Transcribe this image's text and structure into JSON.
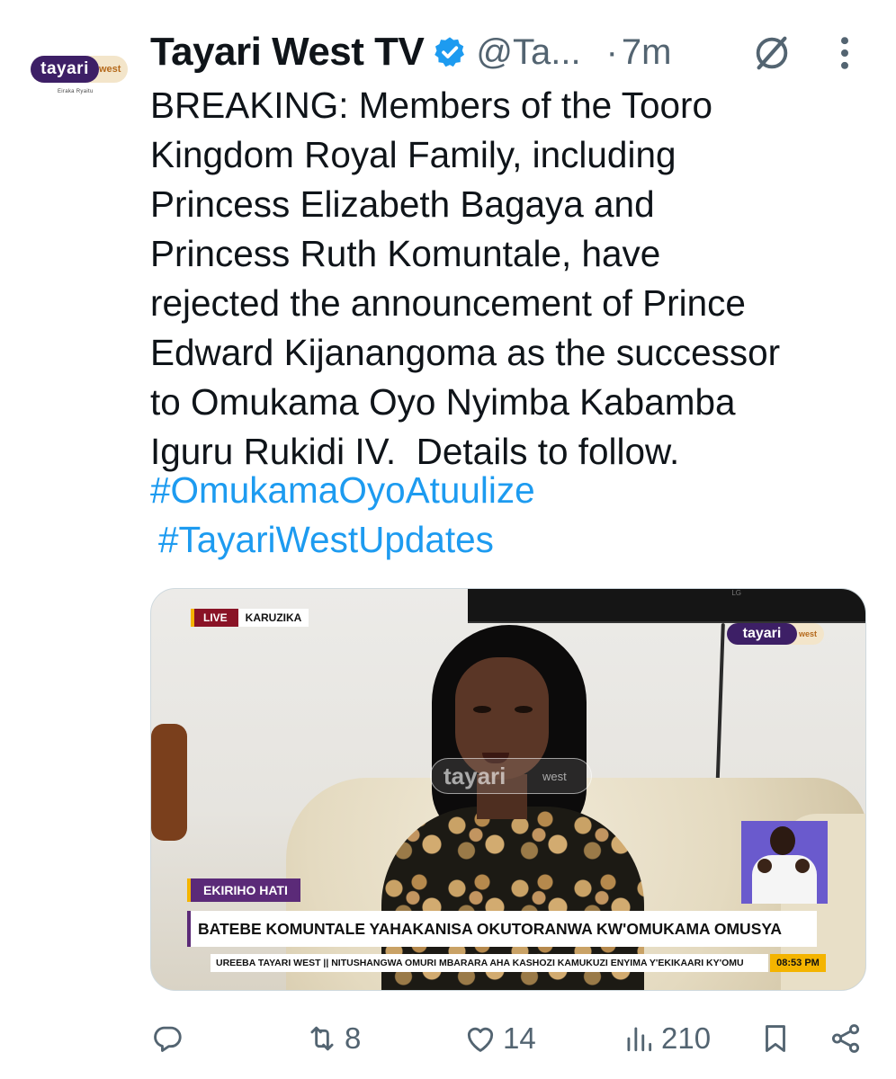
{
  "account": {
    "display_name": "Tayari West TV",
    "handle": "@Ta...",
    "separator": "·",
    "time": "7m",
    "avatar": {
      "brand": "tayari",
      "brand_suffix": "west",
      "tagline": "Eiraka Ryaitu"
    },
    "verified_color": "#1d9bf0"
  },
  "tweet": {
    "text": "BREAKING: Members of the Tooro\nKingdom Royal Family, including\nPrincess Elizabeth Bagaya and\nPrincess Ruth Komuntale, have\nrejected the announcement of Prince\nEdward Kijanangoma as the successor\nto Omukama Oyo Nyimba Kabamba\nIguru Rukidi IV.  Details to follow.",
    "hashtags": [
      "#OmukamaOyoAtuulize",
      "#TayariWestUpdates"
    ]
  },
  "media": {
    "live_label": "LIVE",
    "location": "KARUZIKA",
    "channel": {
      "brand": "tayari",
      "brand_suffix": "west"
    },
    "tv_brand": "LG",
    "watermark": {
      "main": "tayari",
      "sub": "west"
    },
    "tag": "EKIRIHO HATI",
    "headline": "BATEBE KOMUNTALE YAHAKANISA OKUTORANWA KW'OMUKAMA OMUSYA",
    "ticker": "UREEBA TAYARI WEST || NITUSHANGWA OMURI MBARARA AHA KASHOZI KAMUKUZI ENYIMA Y'EKIKAARI KY'OMU",
    "clock": "08:53 PM"
  },
  "actions": {
    "reply_icon": "reply-icon",
    "retweet_icon": "retweet-icon",
    "retweets": "8",
    "like_icon": "heart-icon",
    "likes": "14",
    "views_icon": "views-chart-icon",
    "views": "210",
    "bookmark_icon": "bookmark-icon",
    "share_icon": "share-icon"
  },
  "colors": {
    "text": "#0f1419",
    "muted": "#536471",
    "link": "#1d9bf0",
    "brand_purple": "#3d1f66",
    "live_red": "#8a1326",
    "accent_yellow": "#f4b400"
  }
}
